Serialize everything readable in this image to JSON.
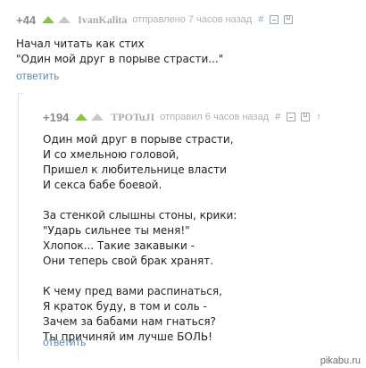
{
  "comments": [
    {
      "rating": "+44",
      "author": "IvanKalita",
      "meta": "отправлено 7 часов назад",
      "icons": [
        "hash-icon",
        "minimize-icon",
        "save-icon"
      ],
      "text": "Начал читать как стих\n\"Один мой друг в порыве страсти...\"",
      "reply_label": "ответить"
    },
    {
      "rating": "+194",
      "author": "TPOTuJI",
      "meta": "отправил 6 часов назад",
      "icons": [
        "hash-icon",
        "minimize-icon",
        "save-icon",
        "arrow-up-icon"
      ],
      "text": "Один мой друг в порыве страсти,\nИ со хмельною головой,\nПришел к любительнице власти\nИ секса бабе боевой.\n\nЗа стенкой слышны стоны, крики:\n\"Ударь сильнее ты меня!\"\nХлопок... Такие закавыки -\nОни теперь свой брак хранят.\n\nК чему пред вами распинаться,\nЯ краток буду, в том и соль -\nЗачем за бабами нам гнаться?\nТы причиняй им лучше БОЛЬ!",
      "reply_label": "ответить"
    }
  ],
  "watermark": "pikabu.ru",
  "colors": {
    "accent": "#5a8bbd",
    "upvote": "#8bc34a",
    "meta": "#b2b2b2"
  }
}
